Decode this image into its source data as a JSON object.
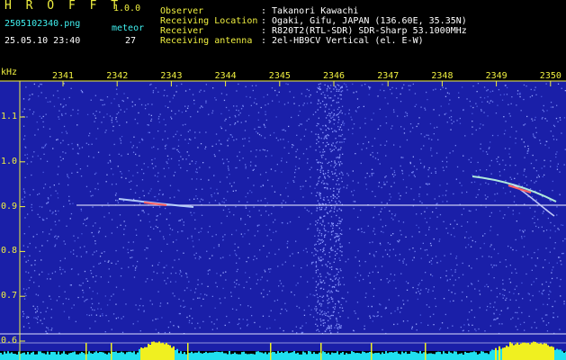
{
  "header": {
    "app_title": "H R O F F T",
    "app_version": "1.0.0",
    "filename": "2505102340.png",
    "datetime": "25.05.10 23:40",
    "meteor_label": "meteor",
    "meteor_count": "27",
    "info_labels": [
      "Observer",
      "Receiving Location",
      "Receiver",
      "Receiving antenna"
    ],
    "info_values": [
      ": Takanori Kawachi",
      ": Ogaki, Gifu, JAPAN (136.60E, 35.35N)",
      ": R820T2(RTL-SDR) SDR-Sharp 53.1000MHz",
      ": 2el-HB9CV Vertical (el. E-W)"
    ]
  },
  "spectrogram": {
    "y_unit": "kHz",
    "x_ticks": [
      "2341",
      "2342",
      "2343",
      "2344",
      "2345",
      "2346",
      "2347",
      "2348",
      "2349",
      "2350"
    ],
    "y_ticks": [
      "1.1",
      "1.0",
      "0.9",
      "0.8",
      "0.7",
      "0.6"
    ],
    "colors": {
      "background": "#1a1fa8",
      "noise": "#6d7df0",
      "carrier": "#e8e8ff",
      "axis": "#f0f040",
      "power": "#20e0f0",
      "power_peak": "#f0f020"
    }
  }
}
